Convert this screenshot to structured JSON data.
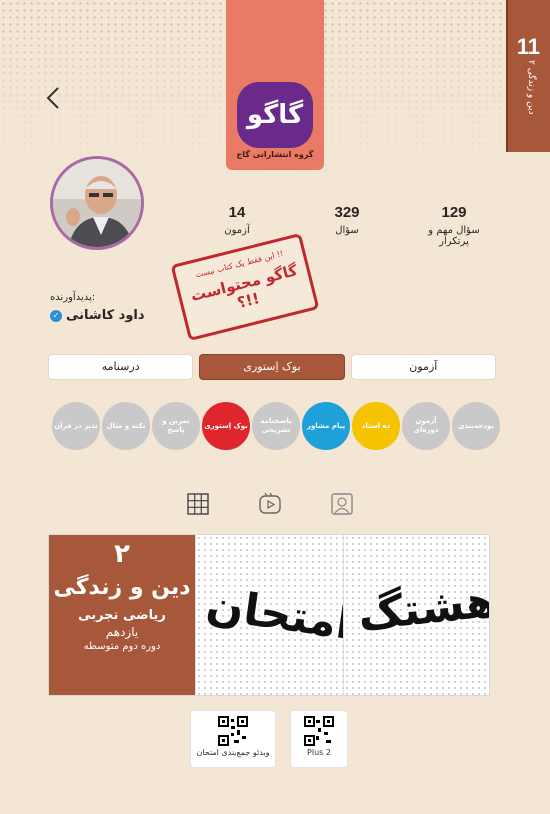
{
  "spine": {
    "number": "11",
    "text": "دین و زندگی ۲"
  },
  "header": {
    "logo_text": "گاگو",
    "publisher": "گروه انتشاراتی گاج"
  },
  "stats": [
    {
      "value": "129",
      "label": "سؤال مهم و پرتکرار"
    },
    {
      "value": "329",
      "label": "سؤال"
    },
    {
      "value": "14",
      "label": "آزمون"
    }
  ],
  "stamp": {
    "line1": "این فقط یک کتاب نیست !!",
    "line2": "گاگو محتواست !!؟"
  },
  "creator": {
    "label": "پدیدآورنده:",
    "name": "داود کاشانی"
  },
  "tabs": [
    {
      "label": "درسنامه"
    },
    {
      "label": "بوک اِستوری"
    },
    {
      "label": "آزمون"
    }
  ],
  "circles": [
    {
      "label": "تدبر در قرآن",
      "color": "#c9c9c9"
    },
    {
      "label": "نکته و مثال",
      "color": "#c9c9c9"
    },
    {
      "label": "تمرین و پاسخ",
      "color": "#c9c9c9"
    },
    {
      "label": "بوک اِستوری",
      "color": "#e0262d"
    },
    {
      "label": "پاسخنامه تشریحی",
      "color": "#c9c9c9"
    },
    {
      "label": "پیام مشاور",
      "color": "#1ea0d8"
    },
    {
      "label": "ده استاد",
      "color": "#f5c400"
    },
    {
      "label": "آزمون دوره‌ای",
      "color": "#c9c9c9"
    },
    {
      "label": "بودجه‌بندی",
      "color": "#c9c9c9"
    }
  ],
  "icons": [
    "grid-icon",
    "reels-icon",
    "tagged-user-icon"
  ],
  "banner": {
    "cover_number": "۲",
    "cover_title": "دین و زندگی",
    "cover_sub1": "ریاضی تجربی",
    "cover_sub2": "یازدهم",
    "cover_sub3": "دوره دوم متوسطه",
    "art1": "امتحان",
    "art2": "هشتگ"
  },
  "qr_cards": [
    {
      "label": "ویدئو جمع‌بندی امتحان"
    },
    {
      "label": "Plus 2"
    }
  ]
}
